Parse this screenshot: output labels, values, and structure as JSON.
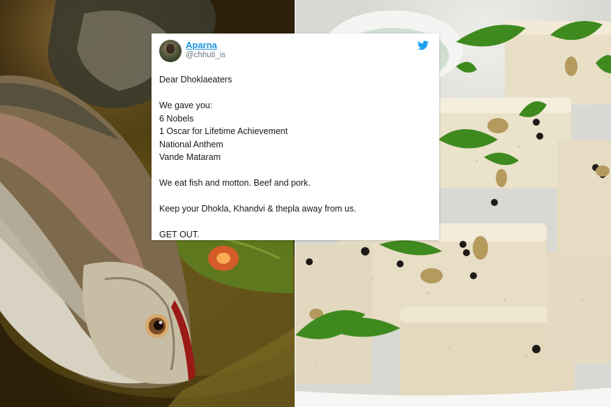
{
  "tweet": {
    "display_name": "Aparna",
    "handle": "@chhuti_is",
    "logo_icon": "twitter-bird-icon",
    "lines": [
      "Dear Dhoklaeaters",
      "We gave you:",
      "6 Nobels",
      "1 Oscar for Lifetime Achievement",
      "National Anthem",
      "Vande Mataram",
      "We eat fish and motton. Beef and pork.",
      "Keep your Dhokla, Khandvi & thepla away from us.",
      "GET OUT."
    ]
  },
  "images": {
    "left_photo": "fish",
    "right_photo": "dhokla"
  },
  "colors": {
    "link_blue": "#1b95e0",
    "handle_gray": "#657786",
    "text_dark": "#14171a",
    "card_bg": "#ffffff"
  }
}
